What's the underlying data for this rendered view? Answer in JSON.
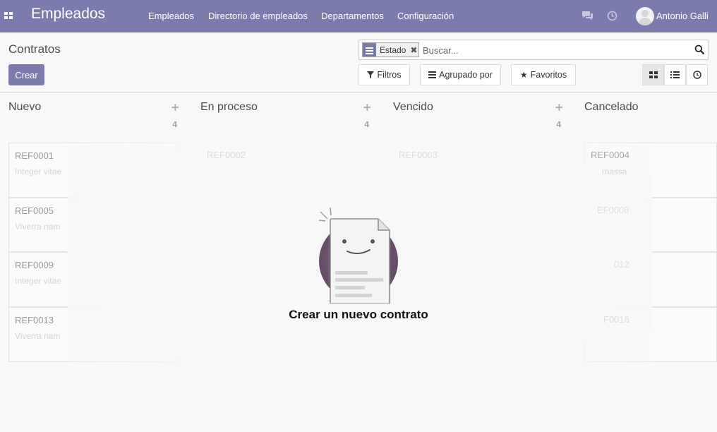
{
  "topbar": {
    "app_title": "Empleados",
    "menu": [
      "Empleados",
      "Directorio de empleados",
      "Departamentos",
      "Configuración"
    ],
    "user_name": "Antonio Galli",
    "bg_color": "#7c7bad"
  },
  "control_panel": {
    "breadcrumb": "Contratos",
    "create_label": "Crear",
    "search": {
      "facet_label": "Estado",
      "placeholder": "Buscar..."
    },
    "filters_label": "Filtros",
    "groupby_label": "Agrupado por",
    "favorites_label": "Favoritos",
    "views": [
      "kanban",
      "list",
      "activity"
    ],
    "active_view": "kanban"
  },
  "kanban": {
    "columns": [
      {
        "title": "Nuevo",
        "count": "4"
      },
      {
        "title": "En proceso",
        "count": "4"
      },
      {
        "title": "Vencido",
        "count": "4"
      },
      {
        "title": "Cancelado",
        "count": ""
      }
    ],
    "cards_col1": [
      {
        "ref": "REF0001",
        "desc": "Integer vitae"
      },
      {
        "ref": "REF0005",
        "desc": "Viverra nam"
      },
      {
        "ref": "REF0009",
        "desc": "Integer vitae"
      },
      {
        "ref": "REF0013",
        "desc": "Viverra nam"
      }
    ],
    "ghost": {
      "ref2": "REF0002",
      "ref3": "REF0003",
      "ref4": "REF0004",
      "ref4_desc": "massa",
      "ref8": "EF0008",
      "ref12": "012",
      "ref16": "F0016"
    }
  },
  "helper": {
    "text": "Crear un nuevo contrato"
  }
}
